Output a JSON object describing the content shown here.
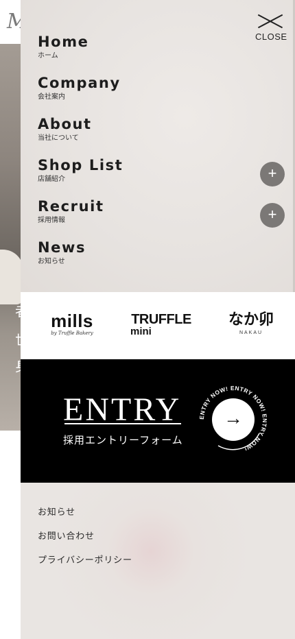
{
  "background_page": {
    "logo": "M",
    "chars": [
      "者",
      "世",
      "身"
    ]
  },
  "drawer": {
    "close_label": "CLOSE",
    "nav": [
      {
        "en": "Home",
        "ja": "ホーム",
        "expandable": false
      },
      {
        "en": "Company",
        "ja": "会社案内",
        "expandable": false
      },
      {
        "en": "About",
        "ja": "当社について",
        "expandable": false
      },
      {
        "en": "Shop List",
        "ja": "店舗紹介",
        "expandable": true
      },
      {
        "en": "Recruit",
        "ja": "採用情報",
        "expandable": true
      },
      {
        "en": "News",
        "ja": "お知らせ",
        "expandable": false
      }
    ],
    "plus_glyph": "+",
    "brands": {
      "mills": {
        "name": "mills",
        "sub": "by Truffle Bakery"
      },
      "truffle": {
        "name": "TRUFFLE",
        "sub": "mini"
      },
      "nakau": {
        "name": "なか卯",
        "sub": "NAKAU"
      }
    },
    "entry": {
      "title": "ENTRY",
      "subtitle": "採用エントリーフォーム",
      "ring_text": "ENTRY NOW! ENTRY NOW! ENTRY NOW!",
      "arrow": "→"
    },
    "footer_links": [
      "お知らせ",
      "お問い合わせ",
      "プライバシーポリシー"
    ]
  },
  "colors": {
    "drawer_bg": "#e6e2df",
    "plus_button": "#7b7876",
    "entry_bg": "#000000",
    "text": "#1d1d1d"
  }
}
